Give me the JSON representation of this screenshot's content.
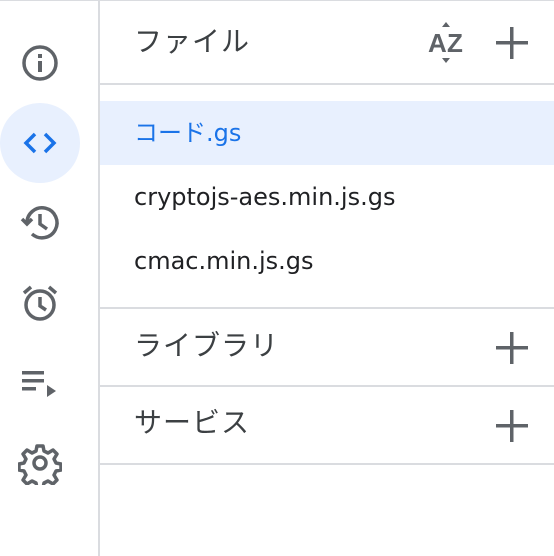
{
  "rail": {
    "items": [
      {
        "name": "overview",
        "icon": "info-icon",
        "active": false
      },
      {
        "name": "editor",
        "icon": "code-icon",
        "active": true
      },
      {
        "name": "executions",
        "icon": "history-icon",
        "active": false
      },
      {
        "name": "triggers",
        "icon": "alarm-icon",
        "active": false
      },
      {
        "name": "execution-log",
        "icon": "playlist-play-icon",
        "active": false
      },
      {
        "name": "settings",
        "icon": "gear-icon",
        "active": false
      }
    ],
    "active_color": "#1a73e8",
    "icon_color": "#5f6368"
  },
  "files": {
    "title": "ファイル",
    "sort_icon": "sort-az-icon",
    "add_icon": "plus-icon",
    "items": [
      {
        "label": "コード.gs",
        "selected": true
      },
      {
        "label": "cryptojs-aes.min.js.gs",
        "selected": false
      },
      {
        "label": "cmac.min.js.gs",
        "selected": false
      }
    ]
  },
  "libraries": {
    "title": "ライブラリ",
    "add_icon": "plus-icon"
  },
  "services": {
    "title": "サービス",
    "add_icon": "plus-icon"
  }
}
